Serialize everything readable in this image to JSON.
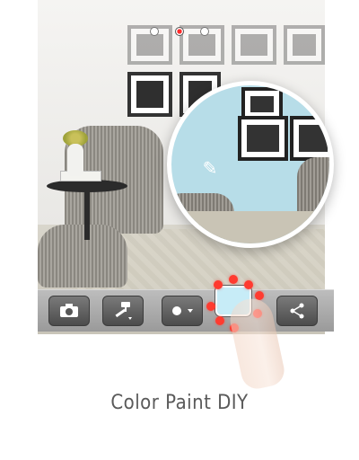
{
  "pager": {
    "page_count": 3,
    "active_index": 1
  },
  "toolbar": {
    "buttons": [
      {
        "icon": "camera-icon"
      },
      {
        "icon": "paint-roller-icon"
      },
      {
        "icon": "brush-size-icon"
      },
      {
        "icon": "color-swatch-icon"
      },
      {
        "icon": "share-icon"
      }
    ],
    "selected_color": "#c7ecf7"
  },
  "caption": {
    "text": "Color Paint DIY"
  },
  "colors": {
    "wall_preview": "#b7dde8",
    "highlight": "#ff3b30"
  }
}
